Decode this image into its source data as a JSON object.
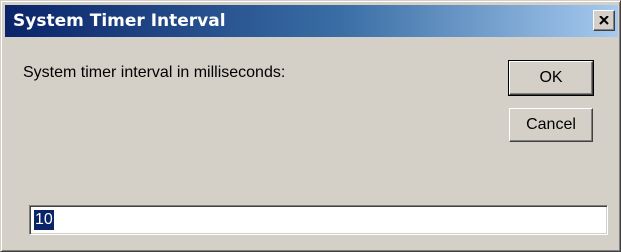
{
  "window": {
    "title": "System Timer Interval",
    "close_glyph": "×"
  },
  "dialog": {
    "prompt": "System timer interval in milliseconds:",
    "ok_label": "OK",
    "cancel_label": "Cancel"
  },
  "input": {
    "value": "10",
    "selected": true
  },
  "colors": {
    "titlebar_start": "#0a246a",
    "titlebar_end": "#a6caf0",
    "dialog_face": "#d4d0c8",
    "selection": "#0a246a"
  },
  "icons": {
    "close": "close-icon"
  }
}
